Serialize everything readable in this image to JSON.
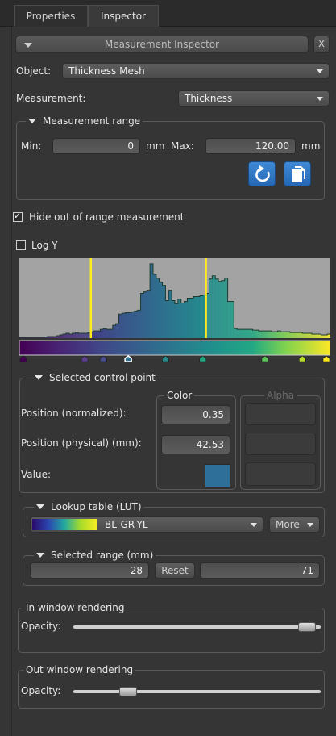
{
  "tabs": [
    {
      "label": "Properties",
      "active": false
    },
    {
      "label": "Inspector",
      "active": true
    }
  ],
  "header": {
    "title": "Measurement Inspector",
    "close_label": "X"
  },
  "object": {
    "label": "Object:",
    "value": "Thickness Mesh"
  },
  "measurement": {
    "label": "Measurement:",
    "value": "Thickness"
  },
  "measurement_range": {
    "title": "Measurement range",
    "min_label": "Min:",
    "min_value": "0",
    "min_unit": "mm",
    "max_label": "Max:",
    "max_value": "120.00",
    "max_unit": "mm"
  },
  "hide_out_of_range": {
    "label": "Hide out of range measurement",
    "checked": true
  },
  "log_y": {
    "label": "Log Y",
    "checked": false
  },
  "histogram": {
    "chart_data": {
      "type": "area",
      "x_range": [
        0,
        1
      ],
      "y_range": [
        0,
        1
      ],
      "values": [
        0.01,
        0.01,
        0.01,
        0.01,
        0.01,
        0.01,
        0.01,
        0.01,
        0.01,
        0.02,
        0.02,
        0.02,
        0.03,
        0.04,
        0.05,
        0.06,
        0.05,
        0.06,
        0.07,
        0.06,
        0.06,
        0.06,
        0.07,
        0.08,
        0.09,
        0.09,
        0.11,
        0.12,
        0.11,
        0.11,
        0.16,
        0.18,
        0.3,
        0.31,
        0.32,
        0.32,
        0.33,
        0.34,
        0.35,
        0.56,
        0.58,
        0.6,
        0.93,
        0.8,
        0.75,
        0.7,
        0.66,
        0.47,
        0.6,
        0.47,
        0.43,
        0.49,
        0.44,
        0.46,
        0.5,
        0.5,
        0.52,
        0.52,
        0.53,
        0.54,
        0.56,
        0.74,
        0.78,
        0.74,
        0.71,
        0.72,
        0.75,
        0.46,
        0.46,
        0.12,
        0.11,
        0.11,
        0.11,
        0.11,
        0.11,
        0.1,
        0.1,
        0.09,
        0.09,
        0.09,
        0.09,
        0.08,
        0.08,
        0.09,
        0.08,
        0.08,
        0.08,
        0.07,
        0.07,
        0.07,
        0.07,
        0.06,
        0.06,
        0.06,
        0.05,
        0.05,
        0.05,
        0.04,
        0.04,
        0.05
      ],
      "selection": [
        0.23,
        0.6
      ]
    },
    "control_points": [
      {
        "position": 0.0,
        "color": "#440154"
      },
      {
        "position": 0.21,
        "color": "#5b3f8a"
      },
      {
        "position": 0.27,
        "color": "#4b4e8d"
      },
      {
        "position": 0.35,
        "color": "#2e6f8e"
      },
      {
        "position": 0.47,
        "color": "#2a8b8b"
      },
      {
        "position": 0.59,
        "color": "#26a680"
      },
      {
        "position": 0.79,
        "color": "#5dc55a"
      },
      {
        "position": 0.91,
        "color": "#b8de29"
      },
      {
        "position": 1.0,
        "color": "#fde725"
      }
    ],
    "selected_point_index": 3
  },
  "selected_control_point": {
    "title": "Selected control point",
    "color_label": "Color",
    "alpha_label": "Alpha",
    "position_normalized_label": "Position (normalized):",
    "position_normalized_value": "0.35",
    "position_physical_label": "Position (physical) (mm):",
    "position_physical_value": "42.53",
    "value_label": "Value:",
    "swatch_color": "#2e6f9a"
  },
  "lut": {
    "title": "Lookup table (LUT)",
    "value": "BL-GR-YL",
    "more_label": "More"
  },
  "selected_range": {
    "title": "Selected range (mm)",
    "min_value": "28",
    "reset_label": "Reset",
    "max_value": "71"
  },
  "in_window": {
    "title": "In window rendering",
    "opacity_label": "Opacity:",
    "opacity": 0.98
  },
  "out_window": {
    "title": "Out window rendering",
    "opacity_label": "Opacity:",
    "opacity": 0.2
  }
}
